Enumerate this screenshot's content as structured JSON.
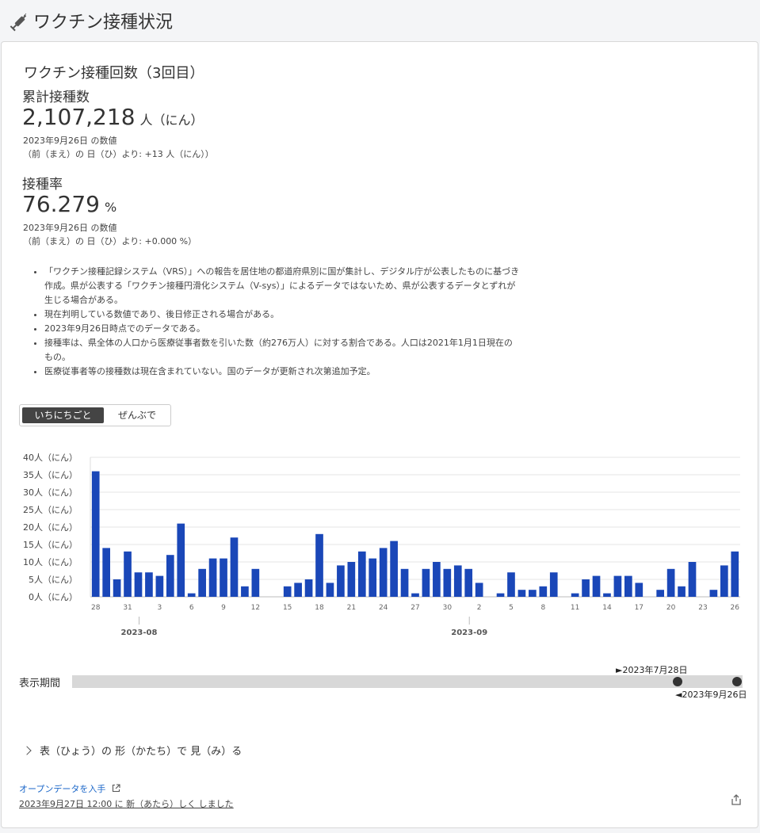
{
  "header": {
    "title": "ワクチン接種状況",
    "icon": "syringe-icon"
  },
  "card": {
    "section_title": "ワクチン接種回数（3回目）",
    "cumulative": {
      "label": "累計接種数",
      "value": "2,107,218",
      "unit": "人（にん）",
      "date_note": "2023年9月26日 の数値",
      "diff_note": "（前（まえ）の 日（ひ）より: +13 人（にん））"
    },
    "rate": {
      "label": "接種率",
      "value": "76.279",
      "unit": "%",
      "date_note": "2023年9月26日 の数値",
      "diff_note": "（前（まえ）の 日（ひ）より: +0.000 %）"
    },
    "notes": [
      "「ワクチン接種記録システム（VRS）」への報告を居住地の都道府県別に国が集計し、デジタル庁が公表したものに基づき作成。県が公表する「ワクチン接種円滑化システム（V-sys）」によるデータではないため、県が公表するデータとずれが生じる場合がある。",
      "現在判明している数値であり、後日修正される場合がある。",
      "2023年9月26日時点でのデータである。",
      "接種率は、県全体の人口から医療従事者数を引いた数（約276万人）に対する割合である。人口は2021年1月1日現在のもの。",
      "医療従事者等の接種数は現在含まれていない。国のデータが更新され次第追加予定。"
    ],
    "toggle": {
      "daily": "いちにちごと",
      "total": "ぜんぶで",
      "selected": "daily"
    },
    "period": {
      "label": "表示期間",
      "start": "►2023年7月28日",
      "end": "◄2023年9月26日"
    },
    "expand_label": "表（ひょう）の 形（かたち）で 見（み）る",
    "open_data": "オープンデータを入手",
    "updated": "2023年9月27日 12:00 に 新（あたら）しく しました",
    "share_icon": "share-icon"
  },
  "chart_data": {
    "type": "bar",
    "color": "#1a47b8",
    "ylim": [
      0,
      40
    ],
    "yticks": [
      {
        "value": 0,
        "label": "0人（にん）"
      },
      {
        "value": 5,
        "label": "5人（にん）"
      },
      {
        "value": 10,
        "label": "10人（にん）"
      },
      {
        "value": 15,
        "label": "15人（にん）"
      },
      {
        "value": 20,
        "label": "20人（にん）"
      },
      {
        "value": 25,
        "label": "25人（にん）"
      },
      {
        "value": 30,
        "label": "30人（にん）"
      },
      {
        "value": 35,
        "label": "35人（にん）"
      },
      {
        "value": 40,
        "label": "40人（にん）"
      }
    ],
    "categories": [
      "7/28",
      "7/29",
      "7/30",
      "7/31",
      "8/1",
      "8/2",
      "8/3",
      "8/4",
      "8/5",
      "8/6",
      "8/7",
      "8/8",
      "8/9",
      "8/10",
      "8/11",
      "8/12",
      "8/13",
      "8/14",
      "8/15",
      "8/16",
      "8/17",
      "8/18",
      "8/19",
      "8/20",
      "8/21",
      "8/22",
      "8/23",
      "8/24",
      "8/25",
      "8/26",
      "8/27",
      "8/28",
      "8/29",
      "8/30",
      "8/31",
      "9/1",
      "9/2",
      "9/3",
      "9/4",
      "9/5",
      "9/6",
      "9/7",
      "9/8",
      "9/9",
      "9/10",
      "9/11",
      "9/12",
      "9/13",
      "9/14",
      "9/15",
      "9/16",
      "9/17",
      "9/18",
      "9/19",
      "9/20",
      "9/21",
      "9/22",
      "9/23",
      "9/24",
      "9/25",
      "9/26"
    ],
    "values": [
      36,
      14,
      5,
      13,
      7,
      7,
      6,
      12,
      21,
      1,
      8,
      11,
      11,
      17,
      3,
      8,
      0,
      0,
      3,
      4,
      5,
      18,
      4,
      9,
      10,
      13,
      11,
      14,
      16,
      8,
      1,
      8,
      10,
      8,
      9,
      8,
      4,
      0,
      1,
      7,
      2,
      2,
      3,
      7,
      0,
      1,
      5,
      6,
      1,
      6,
      6,
      4,
      0,
      2,
      8,
      3,
      10,
      0,
      2,
      9,
      13
    ],
    "xtick_labels": [
      {
        "index": 0,
        "label": "28"
      },
      {
        "index": 3,
        "label": "31"
      },
      {
        "index": 6,
        "label": "3"
      },
      {
        "index": 9,
        "label": "6"
      },
      {
        "index": 12,
        "label": "9"
      },
      {
        "index": 15,
        "label": "12"
      },
      {
        "index": 18,
        "label": "15"
      },
      {
        "index": 21,
        "label": "18"
      },
      {
        "index": 24,
        "label": "21"
      },
      {
        "index": 27,
        "label": "24"
      },
      {
        "index": 30,
        "label": "27"
      },
      {
        "index": 33,
        "label": "30"
      },
      {
        "index": 36,
        "label": "2"
      },
      {
        "index": 39,
        "label": "5"
      },
      {
        "index": 42,
        "label": "8"
      },
      {
        "index": 45,
        "label": "11"
      },
      {
        "index": 48,
        "label": "14"
      },
      {
        "index": 51,
        "label": "17"
      },
      {
        "index": 54,
        "label": "20"
      },
      {
        "index": 57,
        "label": "23"
      },
      {
        "index": 60,
        "label": "26"
      }
    ],
    "month_labels": [
      {
        "index": 4,
        "label": "2023-08"
      },
      {
        "index": 35,
        "label": "2023-09"
      }
    ]
  }
}
